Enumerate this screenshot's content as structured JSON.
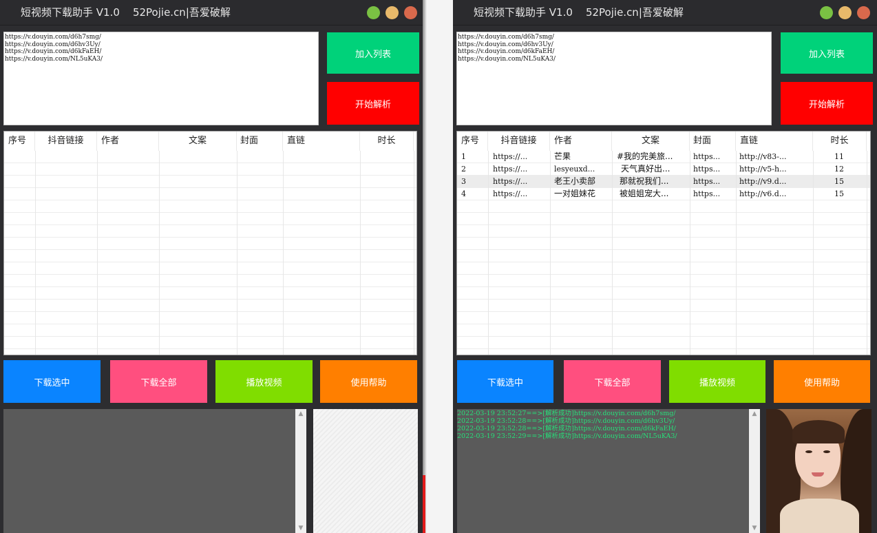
{
  "app": {
    "title": "短视频下载助手 V1.0    52Pojie.cn|吾爱破解"
  },
  "url_text": "https://v.douyin.com/d6h7smg/\nhttps://v.douyin.com/d6hv3Uy/\nhttps://v.douyin.com/d6kFaEH/\nhttps://v.douyin.com/NL5uKA3/",
  "buttons": {
    "add": "加入列表",
    "parse": "开始解析",
    "download_selected": "下载选中",
    "download_all": "下载全部",
    "play": "播放视频",
    "help": "使用帮助"
  },
  "table": {
    "headers": [
      "序号",
      "抖音链接",
      "作者",
      "文案",
      "封面",
      "直链",
      "时长"
    ],
    "rows": [
      {
        "idx": "1",
        "link": "https://...",
        "author": "芒果",
        "text": "#我的完美旅...",
        "cover": "https...",
        "direct": "http://v83-...",
        "duration": "11"
      },
      {
        "idx": "2",
        "link": "https://...",
        "author": "lesyeuxd...",
        "text": "天气真好出...",
        "cover": "https...",
        "direct": "http://v5-h...",
        "duration": "12"
      },
      {
        "idx": "3",
        "link": "https://...",
        "author": "老王小卖部",
        "text": "那就祝我们...",
        "cover": "https...",
        "direct": "http://v9.d...",
        "duration": "15"
      },
      {
        "idx": "4",
        "link": "https://...",
        "author": "一对姐妹花",
        "text": "被姐姐宠大...",
        "cover": "https...",
        "direct": "http://v6.d...",
        "duration": "15"
      }
    ]
  },
  "log_lines": [
    "2022-03-19 23:52:27==>[解析成功]https://v.douyin.com/d6h7smg/",
    "2022-03-19 23:52:28==>[解析成功]https://v.douyin.com/d6hv3Uy/",
    "2022-03-19 23:52:28==>[解析成功]https://v.douyin.com/d6kFaEH/",
    "2022-03-19 23:52:29==>[解析成功]https://v.douyin.com/NL5uKA3/"
  ],
  "colors": {
    "add": "#00d27a",
    "parse": "#ff0000",
    "download_selected": "#0a84ff",
    "download_all": "#ff4f7f",
    "play": "#80dd00",
    "help": "#ff7f00",
    "log_text": "#27e07a"
  },
  "icons": [
    "minimize-dot-green",
    "maximize-dot-yellow",
    "close-dot-red",
    "scroll-up-arrow",
    "scroll-down-arrow"
  ]
}
